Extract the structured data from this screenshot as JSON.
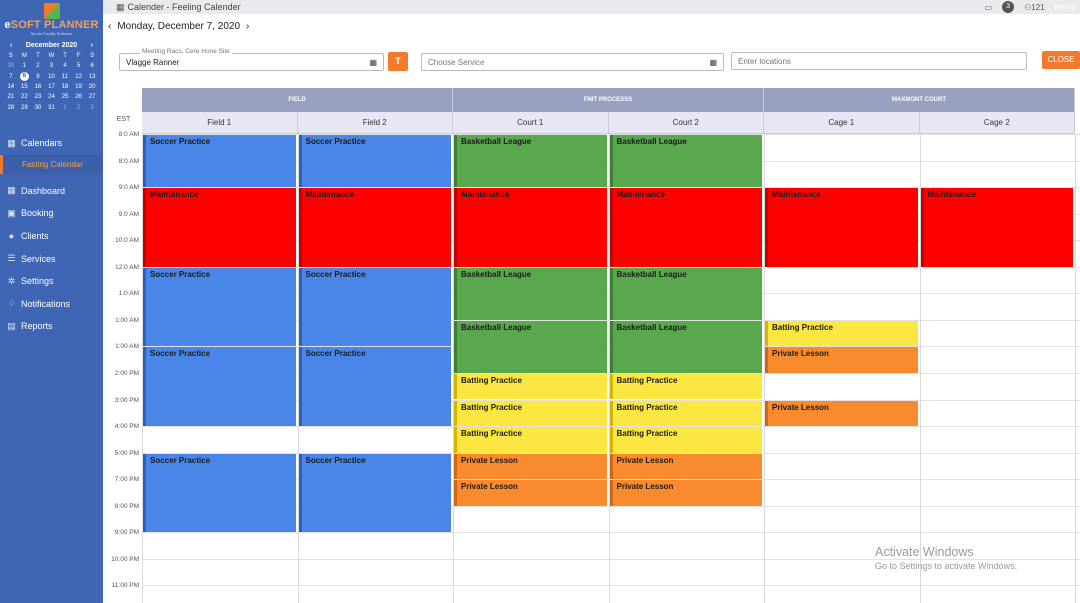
{
  "brand": {
    "name_prefix": "e",
    "name": "SOFT PLANNER",
    "tagline": "Sports Facility Software"
  },
  "window": {
    "title": "Calender - Feeling Calender",
    "notification_count": "3",
    "user_label": "121",
    "home_label": "Home"
  },
  "minical": {
    "month_label": "December 2020",
    "weekdays": [
      "S",
      "M",
      "T",
      "W",
      "T",
      "F",
      "S"
    ],
    "weeks": [
      [
        "30",
        "1",
        "2",
        "3",
        "4",
        "5",
        "6"
      ],
      [
        "7",
        "8",
        "9",
        "10",
        "11",
        "12",
        "13"
      ],
      [
        "14",
        "15",
        "16",
        "17",
        "18",
        "19",
        "20"
      ],
      [
        "21",
        "22",
        "23",
        "24",
        "25",
        "26",
        "27"
      ],
      [
        "28",
        "29",
        "30",
        "31",
        "1",
        "2",
        "3"
      ]
    ]
  },
  "nav": {
    "calendars": "Calendars",
    "fasting_calendar": "Fasting Calendar",
    "dashboard": "Dashboard",
    "booking": "Booking",
    "clients": "Clients",
    "services": "Services",
    "settings": "Settings",
    "notifications": "Notifications",
    "reports": "Reports"
  },
  "datebar": {
    "date": "Monday, December 7, 2020",
    "prev": "‹",
    "next": "›"
  },
  "filters": {
    "site_legend": "Meeting Racs, Cere Hone Site",
    "site_value": "Vlagge Ranner",
    "t_button": "T",
    "service_placeholder": "Choose Service",
    "location_placeholder": "Enter locations",
    "close": "CLOSE"
  },
  "calendar": {
    "timezone": "EST",
    "groups": [
      "FIELD",
      "FNIT PROCESSS",
      "MAXMONT COURT"
    ],
    "columns": [
      "Field 1",
      "Field 2",
      "Court 1",
      "Court 2",
      "Cage 1",
      "Cage 2"
    ],
    "times": [
      "8:0 AM",
      "8:0 AM",
      "9:0 AM",
      "9:0 AM",
      "10:0 AM",
      "12:0 AM",
      "1:0 AM",
      "1:00 AM",
      "1:00 AM",
      "2:00 PM",
      "3:00 PM",
      "4:00 PM",
      "5:00 PM",
      "7:00 PM",
      "8:00 PM",
      "9:00 PM",
      "10:00 PM",
      "11:00 PM"
    ],
    "events": [
      {
        "col": 0,
        "start": 0,
        "end": 2,
        "title": "Soccer Practice",
        "color": "blue"
      },
      {
        "col": 1,
        "start": 0,
        "end": 2,
        "title": "Soccer Practice",
        "color": "blue"
      },
      {
        "col": 2,
        "start": 0,
        "end": 2,
        "title": "Basketball League",
        "color": "green"
      },
      {
        "col": 3,
        "start": 0,
        "end": 2,
        "title": "Basketball League",
        "color": "green"
      },
      {
        "col": 0,
        "start": 2,
        "end": 5,
        "title": "Maintenance",
        "color": "red"
      },
      {
        "col": 1,
        "start": 2,
        "end": 5,
        "title": "Maintenance",
        "color": "red"
      },
      {
        "col": 2,
        "start": 2,
        "end": 5,
        "title": "Maintenance",
        "color": "red"
      },
      {
        "col": 3,
        "start": 2,
        "end": 5,
        "title": "Maintenance",
        "color": "red"
      },
      {
        "col": 4,
        "start": 2,
        "end": 5,
        "title": "Maintenance",
        "color": "red"
      },
      {
        "col": 5,
        "start": 2,
        "end": 5,
        "title": "Maintenance",
        "color": "red"
      },
      {
        "col": 0,
        "start": 5,
        "end": 8,
        "title": "Soccer Practice",
        "color": "blue"
      },
      {
        "col": 1,
        "start": 5,
        "end": 8,
        "title": "Soccer Practice",
        "color": "blue"
      },
      {
        "col": 2,
        "start": 5,
        "end": 7,
        "title": "Basketball League",
        "color": "green"
      },
      {
        "col": 3,
        "start": 5,
        "end": 7,
        "title": "Basketball League",
        "color": "green"
      },
      {
        "col": 2,
        "start": 7,
        "end": 9,
        "title": "Basketball League",
        "color": "green"
      },
      {
        "col": 3,
        "start": 7,
        "end": 9,
        "title": "Basketball League",
        "color": "green"
      },
      {
        "col": 4,
        "start": 7,
        "end": 8,
        "title": "Batting Practice",
        "color": "yellow"
      },
      {
        "col": 4,
        "start": 8,
        "end": 9,
        "title": "Private Lesson",
        "color": "orange"
      },
      {
        "col": 0,
        "start": 8,
        "end": 11,
        "title": "Soccer Practice",
        "color": "blue"
      },
      {
        "col": 1,
        "start": 8,
        "end": 11,
        "title": "Soccer Practice",
        "color": "blue"
      },
      {
        "col": 2,
        "start": 9,
        "end": 10,
        "title": "Batting Practice",
        "color": "yellow"
      },
      {
        "col": 3,
        "start": 9,
        "end": 10,
        "title": "Batting Practice",
        "color": "yellow"
      },
      {
        "col": 2,
        "start": 10,
        "end": 11,
        "title": "Batting Practice",
        "color": "yellow"
      },
      {
        "col": 3,
        "start": 10,
        "end": 11,
        "title": "Batting Practice",
        "color": "yellow"
      },
      {
        "col": 4,
        "start": 10,
        "end": 11,
        "title": "Private Lesson",
        "color": "orange"
      },
      {
        "col": 2,
        "start": 11,
        "end": 12,
        "title": "Batting Practice",
        "color": "yellow"
      },
      {
        "col": 3,
        "start": 11,
        "end": 12,
        "title": "Batting Practice",
        "color": "yellow"
      },
      {
        "col": 0,
        "start": 12,
        "end": 15,
        "title": "Soccer Practice",
        "color": "blue"
      },
      {
        "col": 1,
        "start": 12,
        "end": 15,
        "title": "Soccer Practice",
        "color": "blue"
      },
      {
        "col": 2,
        "start": 12,
        "end": 13,
        "title": "Private Lesson",
        "color": "orange"
      },
      {
        "col": 3,
        "start": 12,
        "end": 13,
        "title": "Private Lesson",
        "color": "orange"
      },
      {
        "col": 2,
        "start": 13,
        "end": 14,
        "title": "Private Lesson",
        "color": "orange"
      },
      {
        "col": 3,
        "start": 13,
        "end": 14,
        "title": "Private Lesson",
        "color": "orange"
      }
    ]
  },
  "watermark": {
    "line1": "Activate Windows",
    "line2": "Go to Settings to activate Windows."
  },
  "colors": {
    "sidebar": "#3f66b5",
    "accent": "#f37a2a",
    "blue": "#4a86e8",
    "red": "#ff0000",
    "green": "#5aa84e",
    "yellow": "#fbe642",
    "orange": "#f98b2f"
  }
}
